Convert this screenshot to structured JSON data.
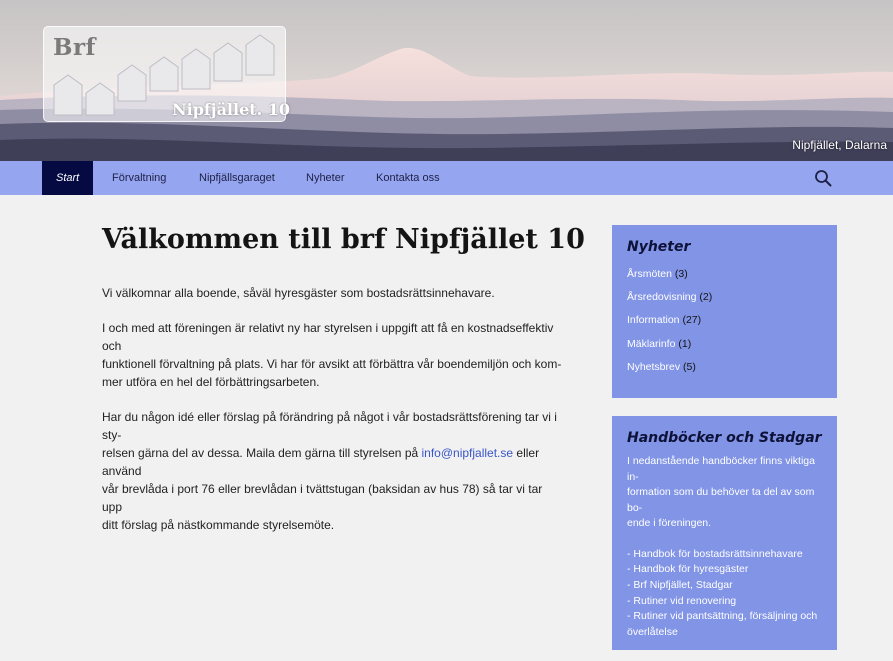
{
  "header": {
    "logo_text": "Brf",
    "site_name": "Nipfjället. 10",
    "image_caption": "Nipfjället, Dalarna"
  },
  "nav": {
    "items": [
      "Start",
      "Förvaltning",
      "Nipfjällsgaraget",
      "Nyheter",
      "Kontakta oss"
    ],
    "active": "Start",
    "search_icon": "search-icon"
  },
  "main": {
    "title": "Välkommen till brf Nipfjället 10",
    "p1": "Vi välkomnar alla boende, såväl hyresgäster som bostadsrättsinnehavare.",
    "p2_lines": [
      "I och med att föreningen är relativt ny har styrelsen i uppgift att få en kostnadseffektiv och",
      "funktionell förvaltning på plats. Vi har för avsikt att förbättra vår boendemiljön och kom-",
      "mer utföra en hel del förbättringsarbeten."
    ],
    "p3_line1": "Har du någon idé eller förslag på förändring på något i vår bostadsrättsförening tar vi i sty-",
    "p3_line2_before": "relsen gärna del av dessa. Maila dem gärna till styrelsen på ",
    "p3_email": "info@nipfjallet.se",
    "p3_line2_after": " eller använd",
    "p3_line3": "vår brevlåda i port 76 eller  brevlådan i tvättstugan (baksidan av hus 78) så tar vi tar upp",
    "p3_line4": "ditt förslag på nästkommande styrelsemöte."
  },
  "sidebar": {
    "news": {
      "title": "Nyheter",
      "categories": [
        {
          "label": "Årsmöten",
          "count": "(3)"
        },
        {
          "label": "Årsredovisning",
          "count": "(2)"
        },
        {
          "label": "Information",
          "count": "(27)"
        },
        {
          "label": "Mäklarinfo",
          "count": "(1)"
        },
        {
          "label": "Nyhetsbrev",
          "count": "(5)"
        }
      ]
    },
    "handbooks": {
      "title": "Handböcker och Stadgar",
      "text_lines": [
        "I nedanstående handböcker finns viktiga in-",
        "formation som du behöver ta del av som bo-",
        "ende i föreningen."
      ],
      "links": [
        "- Handbok för bostadsrättsinnehavare",
        "- Handbok för hyresgäster",
        "- Brf Nipfjället, Stadgar",
        "- Rutiner vid renovering",
        "- Rutiner vid pantsättning, försäljning och",
        "överlåtelse"
      ]
    }
  },
  "colors": {
    "nav_bg": "#96a5ef",
    "nav_active": "#050a42",
    "widget_bg": "#8194e6",
    "page_bg": "#f1f1f1",
    "link": "#3a55c8"
  }
}
